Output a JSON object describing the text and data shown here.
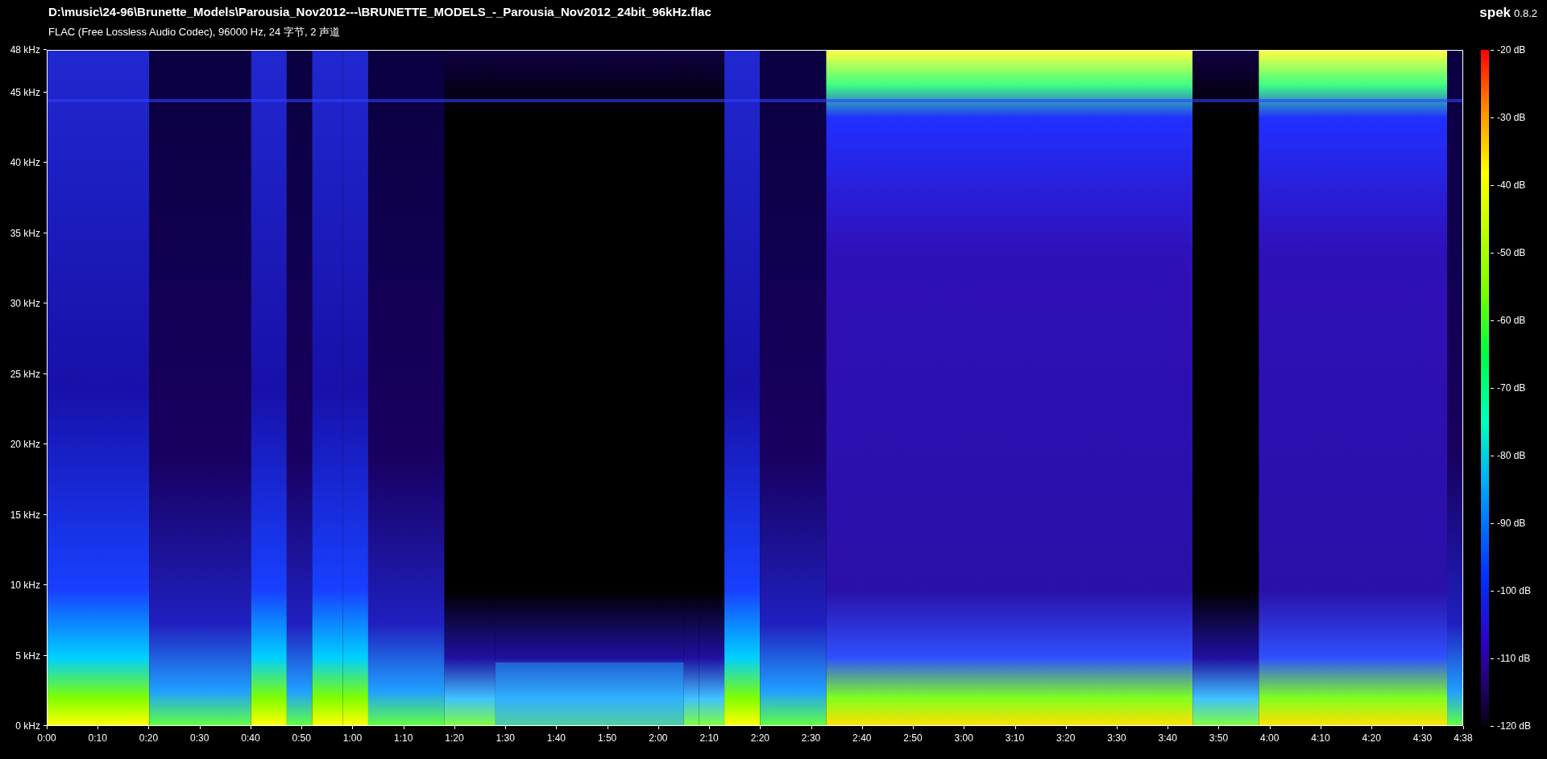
{
  "title": "D:\\music\\24-96\\Brunette_Models\\Parousia_Nov2012---\\BRUNETTE_MODELS_-_Parousia_Nov2012_24bit_96kHz.flac",
  "file_info": "FLAC (Free Lossless Audio Codec), 96000 Hz, 24 字节, 2 声道",
  "app": {
    "name": "spek",
    "version": "0.8.2"
  },
  "frequency_axis": {
    "labels": [
      "48 kHz",
      "45 kHz",
      "40 kHz",
      "35 kHz",
      "30 kHz",
      "25 kHz",
      "20 kHz",
      "15 kHz",
      "10 kHz",
      "5 kHz",
      "0 kHz"
    ]
  },
  "time_axis": {
    "labels": [
      "0:00",
      "0:10",
      "0:20",
      "0:30",
      "0:40",
      "0:50",
      "1:00",
      "1:10",
      "1:20",
      "1:30",
      "1:40",
      "1:50",
      "2:00",
      "2:10",
      "2:20",
      "2:30",
      "2:40",
      "2:50",
      "3:00",
      "3:10",
      "3:20",
      "3:30",
      "3:40",
      "3:50",
      "4:00",
      "4:10",
      "4:20",
      "4:30",
      "4:38"
    ]
  },
  "db_scale": {
    "labels": [
      "-20 dB",
      "-30 dB",
      "-40 dB",
      "-50 dB",
      "-60 dB",
      "-70 dB",
      "-80 dB",
      "-90 dB",
      "-100 dB",
      "-110 dB",
      "-120 dB"
    ]
  }
}
